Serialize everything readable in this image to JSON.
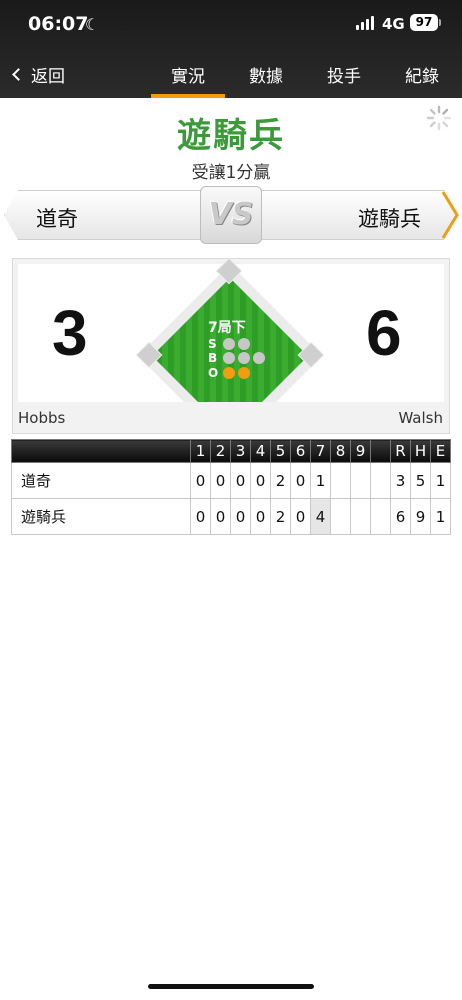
{
  "status_bar": {
    "time": "06:07",
    "network": "4G",
    "battery": "97"
  },
  "nav": {
    "back_label": "返回",
    "tabs": [
      {
        "label": "實況",
        "active": true
      },
      {
        "label": "數據",
        "active": false
      },
      {
        "label": "投手",
        "active": false
      },
      {
        "label": "紀錄",
        "active": false
      }
    ]
  },
  "game": {
    "leader": "遊騎兵",
    "status_text": "受讓1分贏",
    "vs_label": "VS",
    "away": {
      "name": "道奇",
      "score": "3",
      "pitcher": "Hobbs"
    },
    "home": {
      "name": "遊騎兵",
      "score": "6",
      "pitcher": "Walsh"
    },
    "inning_text": "7局下",
    "count": {
      "strike_label": "S",
      "ball_label": "B",
      "out_label": "O",
      "strikes": 0,
      "balls": 0,
      "outs": 2
    }
  },
  "linescore": {
    "headers": [
      "1",
      "2",
      "3",
      "4",
      "5",
      "6",
      "7",
      "8",
      "9",
      "",
      "R",
      "H",
      "E"
    ],
    "rows": [
      {
        "team": "道奇",
        "cells": [
          "0",
          "0",
          "0",
          "0",
          "2",
          "0",
          "1",
          "",
          "",
          "",
          "3",
          "5",
          "1"
        ]
      },
      {
        "team": "遊騎兵",
        "cells": [
          "0",
          "0",
          "0",
          "0",
          "2",
          "0",
          "4",
          "",
          "",
          "",
          "6",
          "9",
          "1"
        ]
      }
    ]
  },
  "colors": {
    "accent": "#f39c12",
    "leader_green": "#3d9a3a",
    "field_green": "#2e9e27"
  }
}
